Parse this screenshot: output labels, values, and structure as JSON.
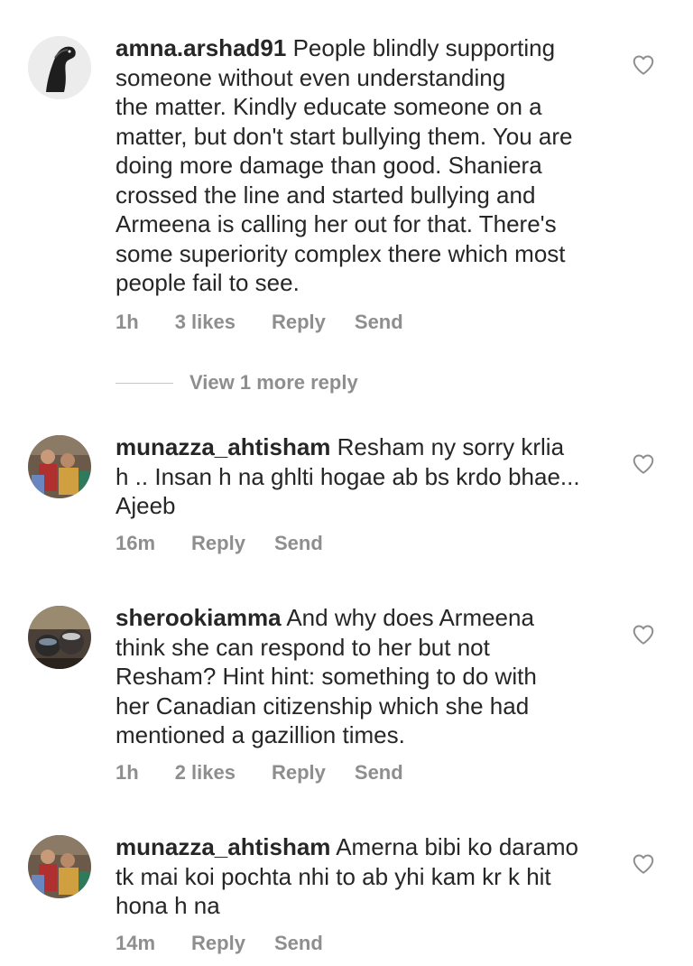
{
  "comments": [
    {
      "username": "amna.arshad91",
      "text": "People blindly supporting\nsomeone without even understanding\nthe matter. Kindly educate someone on a\nmatter, but don't start bullying them. You are\ndoing more damage than good. Shaniera\ncrossed the line and started bullying and\nArmeena is calling her out for that. There's\nsome superiority complex there which most\npeople fail to see.",
      "time": "1h",
      "likes": "3 likes",
      "reply": "Reply",
      "send": "Send"
    },
    {
      "username": "munazza_ahtisham",
      "text": "Resham ny sorry krlia\nh .. Insan h na ghlti hogae ab bs krdo bhae...\nAjeeb",
      "time": "16m",
      "likes": "",
      "reply": "Reply",
      "send": "Send"
    },
    {
      "username": "sherookiamma",
      "text": "And why does Armeena\nthink she can respond to her but not\nResham? Hint hint: something to do with\nher Canadian citizenship which she had\nmentioned a gazillion times.",
      "time": "1h",
      "likes": "2 likes",
      "reply": "Reply",
      "send": "Send"
    },
    {
      "username": "munazza_ahtisham",
      "text": "Amerna bibi ko daramo\ntk mai koi pochta nhi to ab yhi kam kr k hit\nhona h na",
      "time": "14m",
      "likes": "",
      "reply": "Reply",
      "send": "Send"
    }
  ],
  "view_more": "View 1 more reply",
  "icons": {
    "like": "heart-outline-icon",
    "avatar_1": "horse-avatar",
    "avatar_2": "family-photo-avatar",
    "avatar_3": "pottery-photo-avatar"
  },
  "colors": {
    "text": "#262626",
    "muted": "#8e8e8e",
    "divider": "#c7c7c7"
  }
}
